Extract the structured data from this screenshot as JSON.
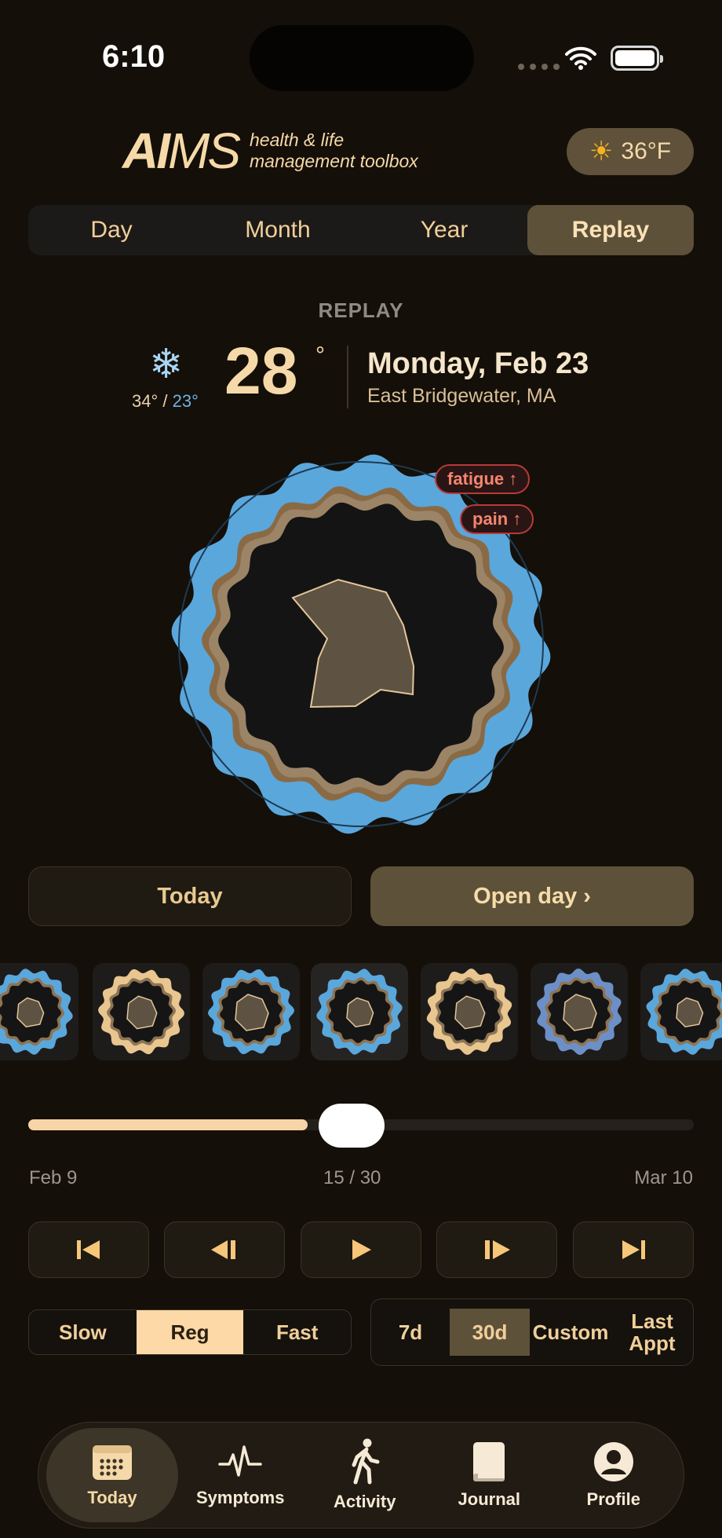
{
  "status": {
    "time": "6:10"
  },
  "header": {
    "brand_bold": "AI",
    "brand_light": "MS",
    "tagline_1": "health & life",
    "tagline_2": "management toolbox",
    "weather_pill": {
      "icon": "sun-icon",
      "temp": "36°F"
    }
  },
  "view_tabs": [
    "Day",
    "Month",
    "Year",
    "Replay"
  ],
  "active_view": "Replay",
  "replay": {
    "label": "REPLAY",
    "weather_icon": "snowflake-icon",
    "high": "34°",
    "separator": "/",
    "low": "23°",
    "temp": "28",
    "deg": "°",
    "date": "Monday, Feb 23",
    "location": "East Bridgewater, MA",
    "tags": [
      "fatigue ↑",
      "pain ↑"
    ]
  },
  "actions": {
    "today": "Today",
    "open_day": "Open day ›"
  },
  "timeline": {
    "start": "Feb 9",
    "position": "15 / 30",
    "end": "Mar 10",
    "current_index": 15,
    "total": 30,
    "progress": 0.5
  },
  "playback": [
    "skip-to-start-icon",
    "step-back-icon",
    "play-icon",
    "step-forward-icon",
    "skip-to-end-icon"
  ],
  "speed": {
    "options": [
      "Slow",
      "Reg",
      "Fast"
    ],
    "selected": "Reg"
  },
  "range": {
    "options": [
      "7d",
      "30d",
      "Custom",
      "Last Appt"
    ],
    "selected": "30d"
  },
  "tabbar": [
    {
      "label": "Today",
      "icon": "calendar-icon"
    },
    {
      "label": "Symptoms",
      "icon": "pulse-icon"
    },
    {
      "label": "Activity",
      "icon": "walking-icon"
    },
    {
      "label": "Journal",
      "icon": "book-icon"
    },
    {
      "label": "Profile",
      "icon": "person-icon"
    }
  ],
  "active_tab": "Today",
  "colors": {
    "accent": "#f6d9a8",
    "panel": "#5e5139",
    "ring_blue": "#5aa7dc",
    "tag_red": "#b73a3a",
    "background": "#140f08"
  }
}
